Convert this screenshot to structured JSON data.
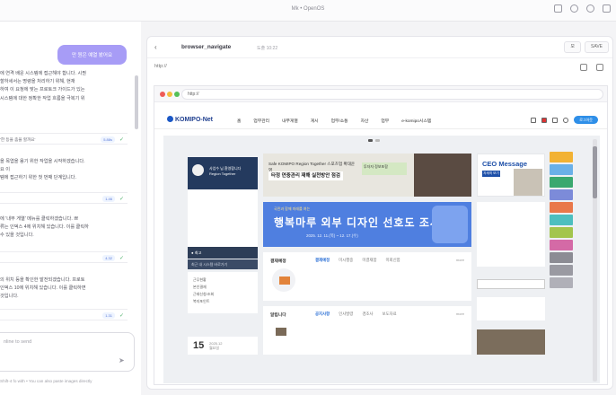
{
  "window": {
    "title": "Mk • OpenOS"
  },
  "chat": {
    "user_message": "만 원은 예열 봤어요",
    "messages": [
      "에 연격 배운 시스템에 접근해야 합니다. 시퀀\n할하세서는 명령을 처리하기 위해, 현재\n하여 이 요청에 맞는 프로토크 가이드가 있는\n시스템에 대한 정확한 작업 흐름을 극복기 위",
      "을 목엽을 용기 위한 작업을 시작하겠습니다.\n                                            요 이\n템에 접근하기 위한 첫 번째 단계입니다.",
      "에 '내부 게열' 메뉴를 클릭하겠습니다. 쁘\n류는 인덱스 4에 위치해 있습니다. 이를 클릭하\n수 있을 것입니다.",
      "의 위치 등을 확인한 발전되겠습니다. 프로토\n인덱스 10에 위치해 있습니다. 이를 클릭하면\n것입니다."
    ],
    "tools": [
      {
        "label": "'한 등을 좀을 할까요'",
        "badge": "5.88s"
      },
      {
        "label": "",
        "badge": "1.46"
      },
      {
        "label": "",
        "badge": "4.32"
      },
      {
        "label": "",
        "badge": "1.31"
      }
    ],
    "input_placeholder": "nline to send",
    "hint": "Shift-4 fo with  • You can also paste images directly"
  },
  "panel": {
    "tool_name": "browser_navigate",
    "tool_sub": "도출 10:22",
    "btn_left": "모",
    "btn_right": "SAVE",
    "url": "http://",
    "browser_url": "http://"
  },
  "site": {
    "logo": "KOMIPO-Net",
    "nav": [
      "홈",
      "업무관리",
      "내부게열",
      "게시",
      "업무/소통",
      "자산",
      "업무",
      "e-komipo시스템"
    ],
    "nav_pill": "로그아웃",
    "profile_name": "사업수 님 환영합니다\nRegion Together",
    "left_band": "● 최고",
    "left_band2": "최근 내 시스템 바로가기",
    "quick_links": [
      "근무현황",
      "본인결재",
      "근태신청/조회",
      "복지포인트"
    ],
    "date": "15",
    "date_sub": "2025.12\n월요일",
    "banner1_text": "Safe KOMIPO Region Together 스포츠업 확대운영",
    "banner1_hl": "타정 연중관리 재해 실천방안 점검",
    "banner1_sub": "투자자 정보포함",
    "banner2_tag": "국민과 함께 미래를 여는",
    "banner2_title": "행복마루 외부 디자인 선호도 조사",
    "banner2_date": "2025. 12. 11.(목) ~ 12. 17.(수)",
    "card1_title": "결재예정",
    "card1_tabs": [
      "결재예정",
      "미시행중",
      "미결재함",
      "미회신함"
    ],
    "card1_more": "more",
    "card2_title": "알립니다",
    "card2_tabs": [
      "공지사항",
      "인사발령",
      "경조사",
      "보도자료"
    ],
    "ceo_title": "CEO Message",
    "ceo_btn": "자세히 보기",
    "tile_colors": [
      "#f2b233",
      "#6ab0e8",
      "#3aa86f",
      "#7c8bd9",
      "#e9784a",
      "#4dbfbf",
      "#a3c54d",
      "#d46aa6",
      "#8c8c94",
      "#9a9aa2",
      "#b0b0b8"
    ]
  }
}
